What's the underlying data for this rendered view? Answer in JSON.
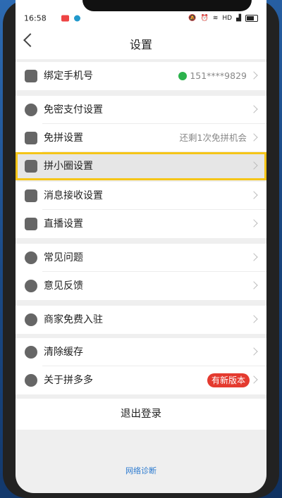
{
  "status": {
    "time": "16:58",
    "network": "HD"
  },
  "header": {
    "title": "设置"
  },
  "groups": [
    {
      "items": [
        {
          "label": "绑定手机号",
          "value": "151****9829",
          "icon": "phone-icon"
        }
      ]
    },
    {
      "items": [
        {
          "label": "免密支付设置",
          "icon": "key-icon"
        },
        {
          "label": "免拼设置",
          "value": "还剩1次免拼机会",
          "icon": "copy-icon"
        },
        {
          "label": "拼小圈设置",
          "icon": "bag-icon"
        },
        {
          "label": "消息接收设置",
          "icon": "mail-icon"
        },
        {
          "label": "直播设置",
          "icon": "video-icon"
        }
      ]
    },
    {
      "items": [
        {
          "label": "常见问题",
          "icon": "question-icon"
        },
        {
          "label": "意见反馈",
          "icon": "edit-icon"
        }
      ]
    },
    {
      "items": [
        {
          "label": "商家免费入驻",
          "icon": "shop-icon"
        }
      ]
    },
    {
      "items": [
        {
          "label": "清除缓存",
          "icon": "broom-icon"
        },
        {
          "label": "关于拼多多",
          "badge": "有新版本",
          "icon": "info-icon"
        }
      ]
    }
  ],
  "logout_label": "退出登录",
  "diagnose_label": "网络诊断",
  "colors": {
    "accent": "#f5c518",
    "badge": "#e43a2f",
    "link": "#2d7bd0"
  }
}
